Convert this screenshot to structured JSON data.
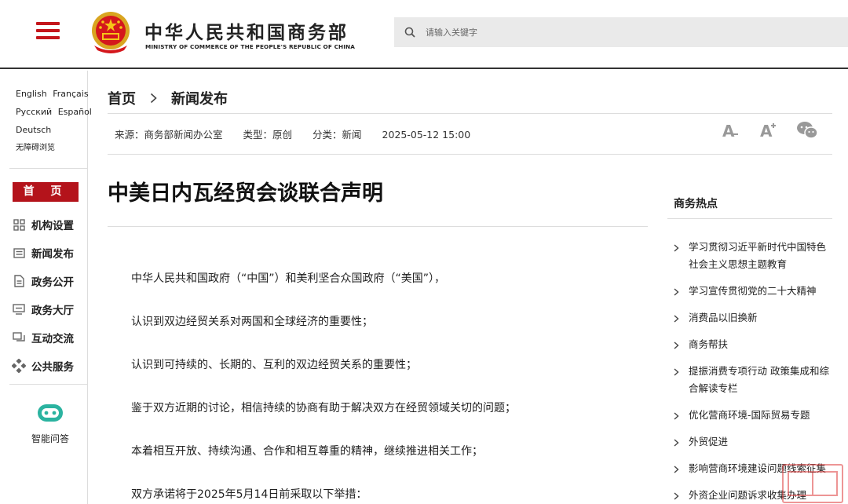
{
  "header": {
    "brand_cn": "中华人民共和国商务部",
    "brand_en": "MINISTRY OF COMMERCE OF THE PEOPLE'S REPUBLIC OF CHINA",
    "search_placeholder": "请输入关键字"
  },
  "sidebar": {
    "languages": [
      [
        "English",
        "Français"
      ],
      [
        "Русский",
        "Español"
      ],
      [
        "Deutsch"
      ]
    ],
    "accessibility": "无障碍浏览",
    "home": "首 页",
    "nav": [
      {
        "label": "机构设置",
        "icon": "org-structure-icon"
      },
      {
        "label": "新闻发布",
        "icon": "news-icon"
      },
      {
        "label": "政务公开",
        "icon": "document-icon"
      },
      {
        "label": "政务大厅",
        "icon": "service-hall-icon"
      },
      {
        "label": "互动交流",
        "icon": "interaction-icon"
      },
      {
        "label": "公共服务",
        "icon": "public-service-icon"
      }
    ],
    "assistant": "智能问答"
  },
  "breadcrumb": [
    "首页",
    "新闻发布"
  ],
  "meta": {
    "source": "来源：商务部新闻办公室",
    "type": "类型：原创",
    "category": "分类：新闻",
    "datetime": "2025-05-12 15:00"
  },
  "article": {
    "title": "中美日内瓦经贸会谈联合声明",
    "paragraphs": [
      "中华人民共和国政府（“中国”）和美利坚合众国政府（“美国”），",
      "认识到双边经贸关系对两国和全球经济的重要性；",
      "认识到可持续的、长期的、互利的双边经贸关系的重要性；",
      "鉴于双方近期的讨论，相信持续的协商有助于解决双方在经贸领域关切的问题；",
      "本着相互开放、持续沟通、合作和相互尊重的精神，继续推进相关工作；",
      "双方承诺将于2025年5月14日前采取以下举措："
    ]
  },
  "hot": {
    "title": "商务热点",
    "items": [
      "学习贯彻习近平新时代中国特色社会主义思想主题教育",
      "学习宣传贯彻党的二十大精神",
      "消费品以旧换新",
      "商务帮扶",
      "提振消费专项行动 政策集成和综合解读专栏",
      "优化营商环境-国际贸易专题",
      "外贸促进",
      "影响营商环境建设问题线索征集",
      "外资企业问题诉求收集办理"
    ]
  },
  "colors": {
    "brand_red": "#b4131b",
    "accent_green": "#2bb3a0"
  }
}
